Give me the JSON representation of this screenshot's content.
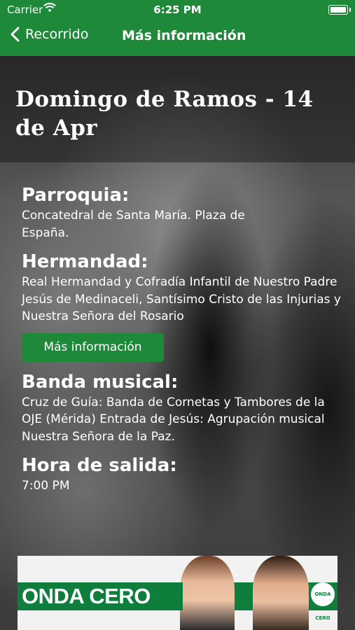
{
  "status_bar": {
    "carrier": "Carrier",
    "time": "6:25 PM",
    "battery_level": 1.0
  },
  "nav": {
    "back_label": "Recorrido",
    "title": "Más información",
    "accent_color": "#1e8a39"
  },
  "event": {
    "title": "Domingo de Ramos - 14 de Apr"
  },
  "details": {
    "parroquia_label": "Parroquia:",
    "parroquia_value": "Concatedral de Santa María. Plaza de España.",
    "hermandad_label": "Hermandad:",
    "hermandad_value": "Real Hermandad y Cofradía Infantil de Nuestro Padre Jesús de Medinaceli, Santísimo Cristo de las Injurias y Nuestra Señora del Rosario",
    "more_info_button": "Más información",
    "banda_label": "Banda musical:",
    "banda_value": "Cruz de Guía: Banda de Cornetas y Tambores de la OJE (Mérida) Entrada de Jesús: Agrupación musical Nuestra Señora de la Paz.",
    "hora_salida_label": "Hora de salida:",
    "hora_salida_value": "7:00 PM"
  },
  "ad": {
    "brand": "ONDA CERO",
    "mark": "ONDA CERO"
  },
  "icons": {
    "back": "chevron-left-icon",
    "wifi": "wifi-icon",
    "battery": "battery-icon"
  }
}
